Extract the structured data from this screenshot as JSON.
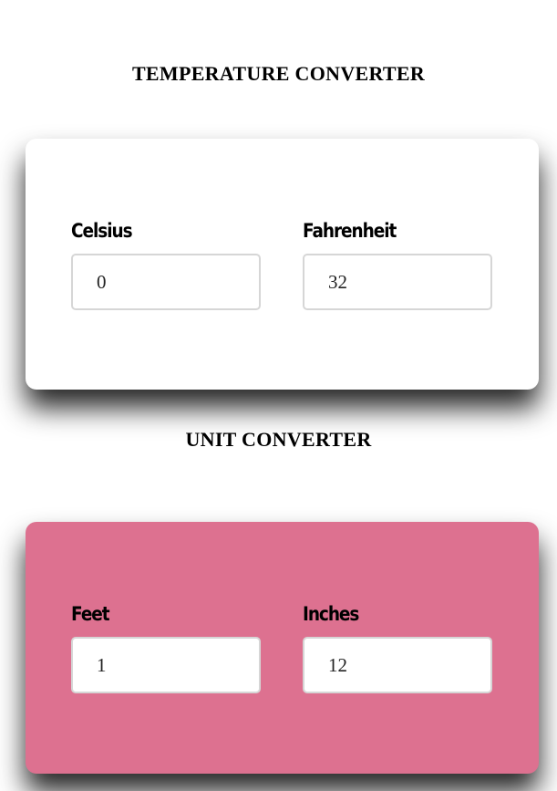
{
  "temperature": {
    "title": "TEMPERATURE CONVERTER",
    "card_color": "#ffffff",
    "celsius": {
      "label": "Celsius",
      "value": "0"
    },
    "fahrenheit": {
      "label": "Fahrenheit",
      "value": "32"
    }
  },
  "unit": {
    "title": "UNIT CONVERTER",
    "card_color": "#dd7190",
    "feet": {
      "label": "Feet",
      "value": "1"
    },
    "inches": {
      "label": "Inches",
      "value": "12"
    }
  }
}
